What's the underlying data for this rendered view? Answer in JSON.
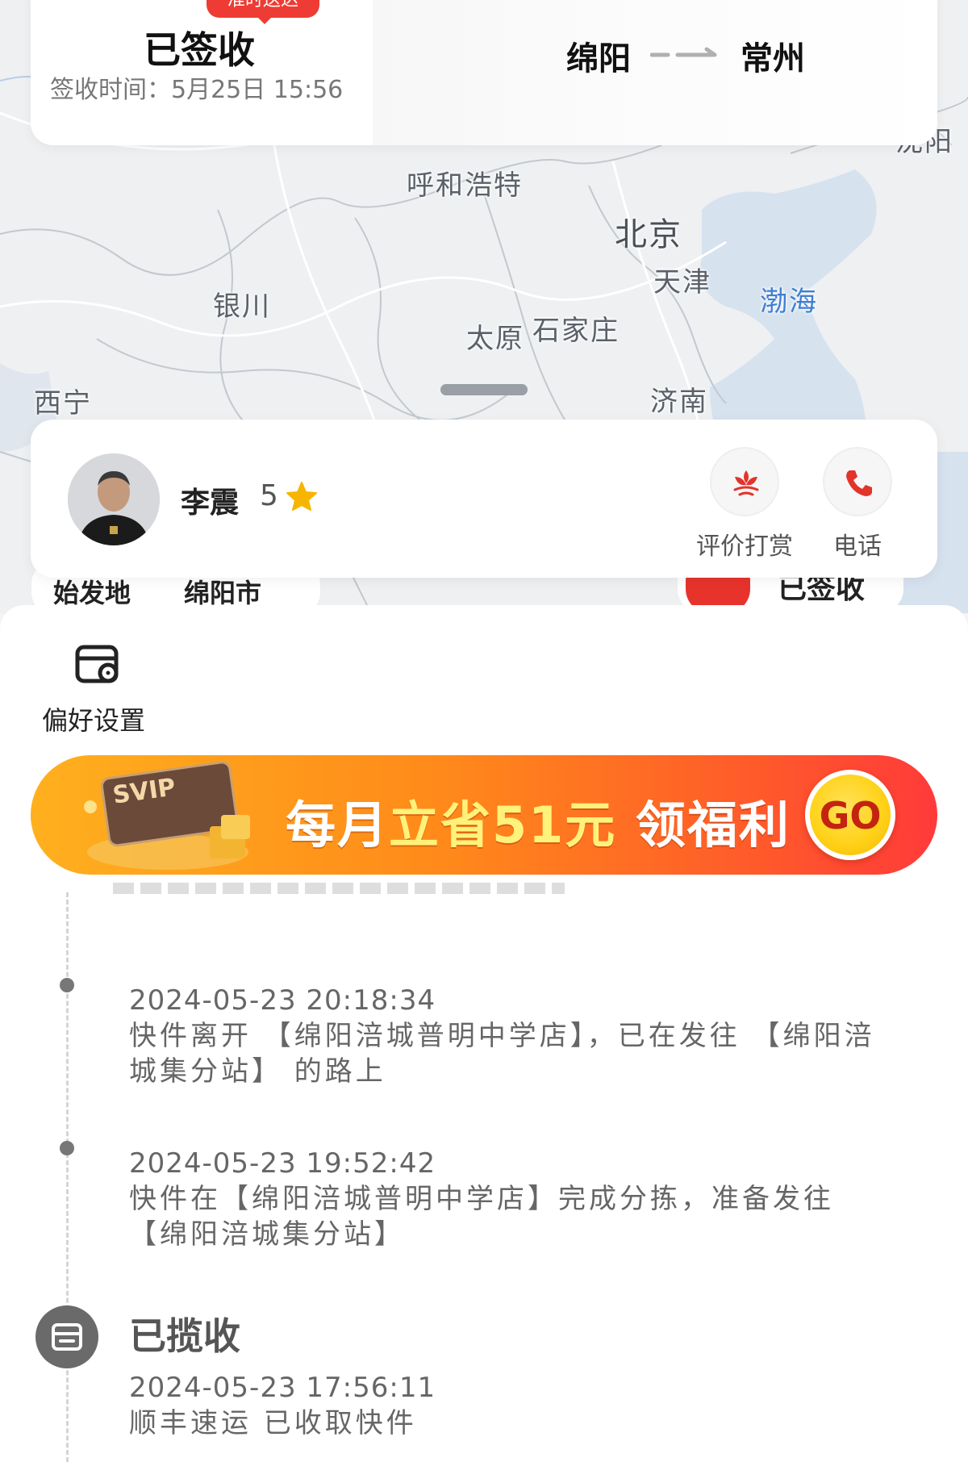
{
  "route_card": {
    "ontime_badge": "准时送达",
    "status": "已签收",
    "signed_time": "签收时间：5月25日 15:56",
    "from_city": "绵阳",
    "to_city": "常州"
  },
  "map": {
    "cities": [
      "呼和浩特",
      "北京",
      "天津",
      "银川",
      "太原",
      "石家庄",
      "渤海",
      "西宁",
      "济南",
      "沈阳"
    ]
  },
  "courier": {
    "name": "李震",
    "rating": "5",
    "actions": [
      {
        "label": "评价打赏",
        "icon": "flower-icon"
      },
      {
        "label": "电话",
        "icon": "phone-icon"
      }
    ]
  },
  "peek": {
    "origin_label": "始发地",
    "origin_city": "绵阳市",
    "status_label": "已签收"
  },
  "sheet": {
    "preference_label": "偏好设置",
    "banner": {
      "badge": "SVIP",
      "text_prefix": "每月",
      "text_highlight": "立省51元",
      "text_suffix": "领福利",
      "go_label": "GO"
    },
    "timeline": [
      {
        "time": "2024-05-23 20:18:34",
        "desc": "快件离开 【绵阳涪城普明中学店】，已在发往 【绵阳涪城集分站】 的路上"
      },
      {
        "time": "2024-05-23 19:52:42",
        "desc": "快件在【绵阳涪城普明中学店】完成分拣，准备发往 【绵阳涪城集分站】"
      }
    ],
    "pickup": {
      "status": "已揽收",
      "time": "2024-05-23 17:56:11",
      "desc": "顺丰速运 已收取快件"
    }
  },
  "colors": {
    "brand_red": "#ee3b33",
    "sea_label": "#3f7fd0",
    "banner_orange": "#ff8a1a"
  }
}
